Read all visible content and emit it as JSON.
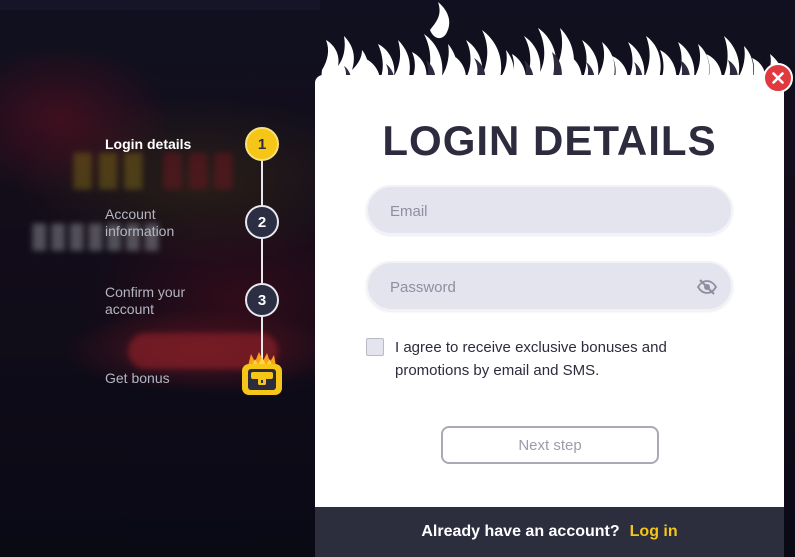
{
  "steps": [
    {
      "label": "Login details",
      "number": "1",
      "active": true
    },
    {
      "label": "Account information",
      "number": "2",
      "active": false
    },
    {
      "label": "Confirm your account",
      "number": "3",
      "active": false
    },
    {
      "label": "Get bonus",
      "number": "",
      "active": false
    }
  ],
  "modal": {
    "title": "LOGIN DETAILS",
    "email_placeholder": "Email",
    "email_value": "",
    "password_placeholder": "Password",
    "password_value": "",
    "agree_text": "I agree to receive exclusive bonuses and promotions by email and SMS.",
    "agree_checked": false,
    "next_label": "Next step",
    "footer_text": "Already have an account?",
    "login_label": "Log in"
  },
  "colors": {
    "accent": "#f5c518",
    "close": "#e0393e",
    "dark": "#2c2d3d"
  }
}
